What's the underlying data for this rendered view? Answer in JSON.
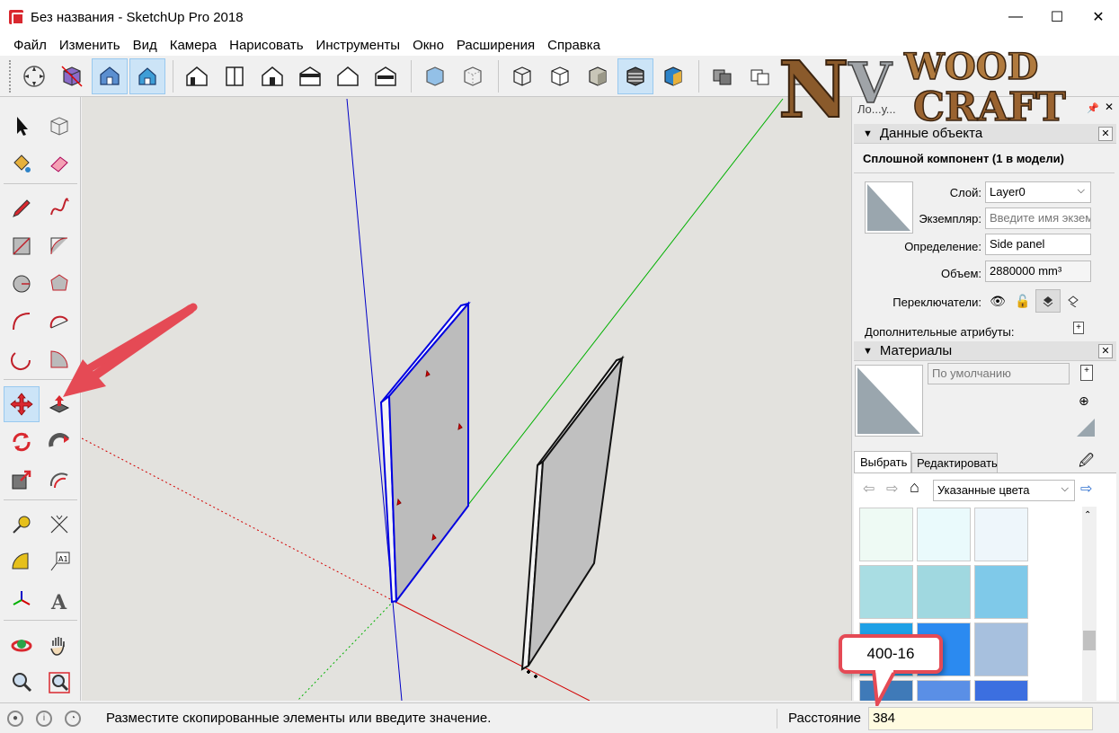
{
  "window": {
    "title": "Без названия - SketchUp Pro 2018",
    "minimize": "—",
    "maximize": "☐",
    "close": "✕"
  },
  "menu": [
    "Файл",
    "Изменить",
    "Вид",
    "Камера",
    "Нарисовать",
    "Инструменты",
    "Окно",
    "Расширения",
    "Справка"
  ],
  "logo": {
    "text": "NV WOOD CRAFT"
  },
  "panel": {
    "title_partial": "Ло...у...",
    "entity_info": {
      "header": "Данные объекта",
      "component_title": "Сплошной компонент (1 в модели)",
      "layer_label": "Слой:",
      "layer_value": "Layer0",
      "instance_label": "Экземпляр:",
      "instance_placeholder": "Введите имя экзем",
      "definition_label": "Определение:",
      "definition_value": "Side panel",
      "volume_label": "Объем:",
      "volume_value": "2880000 mm³",
      "toggles_label": "Переключатели:",
      "advanced_label": "Дополнительные атрибуты:"
    },
    "materials": {
      "header": "Материалы",
      "default_label": "По умолчанию",
      "tab_select": "Выбрать",
      "tab_edit": "Редактировать",
      "collection": "Указанные цвета",
      "swatches": [
        "#eefaf4",
        "#eafafc",
        "#eef6fb",
        "#a9dde3",
        "#a0d8e0",
        "#7fc9e9",
        "#1ea0e6",
        "#2b8af0",
        "#a7c0de",
        "#3f7ab8",
        "#5a8fe6",
        "#3c6fe0"
      ]
    }
  },
  "status": {
    "hint": "Разместите скопированные элементы или введите значение.",
    "measure_label": "Расстояние",
    "measure_value": "384"
  },
  "callout": {
    "text": "400-16"
  },
  "colors": {
    "accent_arrow": "#e54a55",
    "selection": "#0000e0",
    "axis_red": "#d20000",
    "axis_green": "#00b000",
    "axis_blue": "#0000c8"
  }
}
